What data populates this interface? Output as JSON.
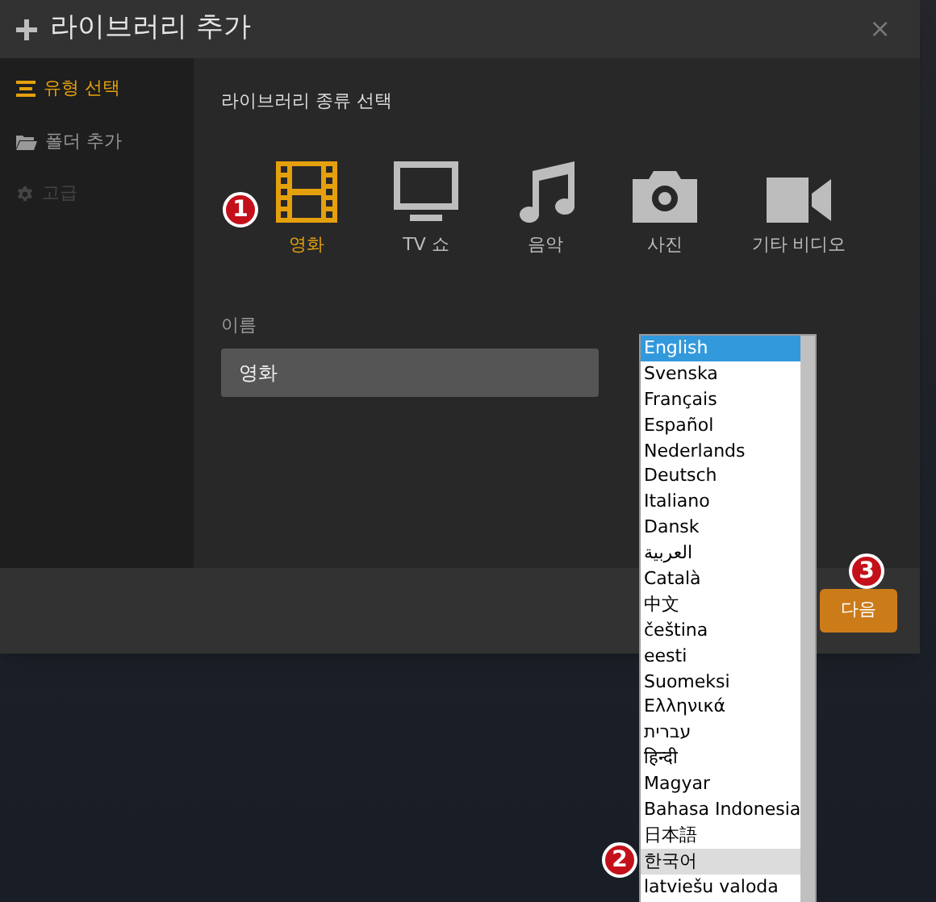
{
  "window": {
    "title": "라이브러리 추가",
    "close": "×"
  },
  "sidebar": {
    "items": [
      {
        "label": "유형 선택",
        "selected": true,
        "disabled": false
      },
      {
        "label": "폴더 추가",
        "selected": false,
        "disabled": false
      },
      {
        "label": "고급",
        "selected": false,
        "disabled": true
      }
    ]
  },
  "section_title": "라이브러리 종류 선택",
  "types": [
    {
      "label": "영화",
      "selected": true
    },
    {
      "label": "TV 쇼",
      "selected": false
    },
    {
      "label": "음악",
      "selected": false
    },
    {
      "label": "사진",
      "selected": false
    },
    {
      "label": "기타 비디오",
      "selected": false
    }
  ],
  "name_field": {
    "label": "이름",
    "value": "영화"
  },
  "language_list": {
    "options": [
      {
        "label": "English",
        "selected": true,
        "highlighted": false
      },
      {
        "label": "Svenska",
        "selected": false,
        "highlighted": false
      },
      {
        "label": "Français",
        "selected": false,
        "highlighted": false
      },
      {
        "label": "Español",
        "selected": false,
        "highlighted": false
      },
      {
        "label": "Nederlands",
        "selected": false,
        "highlighted": false
      },
      {
        "label": "Deutsch",
        "selected": false,
        "highlighted": false
      },
      {
        "label": "Italiano",
        "selected": false,
        "highlighted": false
      },
      {
        "label": "Dansk",
        "selected": false,
        "highlighted": false
      },
      {
        "label": "العربية",
        "selected": false,
        "highlighted": false
      },
      {
        "label": "Català",
        "selected": false,
        "highlighted": false
      },
      {
        "label": "中文",
        "selected": false,
        "highlighted": false
      },
      {
        "label": "čeština",
        "selected": false,
        "highlighted": false
      },
      {
        "label": "eesti",
        "selected": false,
        "highlighted": false
      },
      {
        "label": "Suomeksi",
        "selected": false,
        "highlighted": false
      },
      {
        "label": "Ελληνικά",
        "selected": false,
        "highlighted": false
      },
      {
        "label": "עברית",
        "selected": false,
        "highlighted": false
      },
      {
        "label": "हिन्दी",
        "selected": false,
        "highlighted": false
      },
      {
        "label": "Magyar",
        "selected": false,
        "highlighted": false
      },
      {
        "label": "Bahasa Indonesia",
        "selected": false,
        "highlighted": false
      },
      {
        "label": "日本語",
        "selected": false,
        "highlighted": false
      },
      {
        "label": "한국어",
        "selected": false,
        "highlighted": true
      },
      {
        "label": "latviešu valoda",
        "selected": false,
        "highlighted": false
      }
    ]
  },
  "next_button": "다음",
  "annotations": [
    "1",
    "2",
    "3"
  ]
}
